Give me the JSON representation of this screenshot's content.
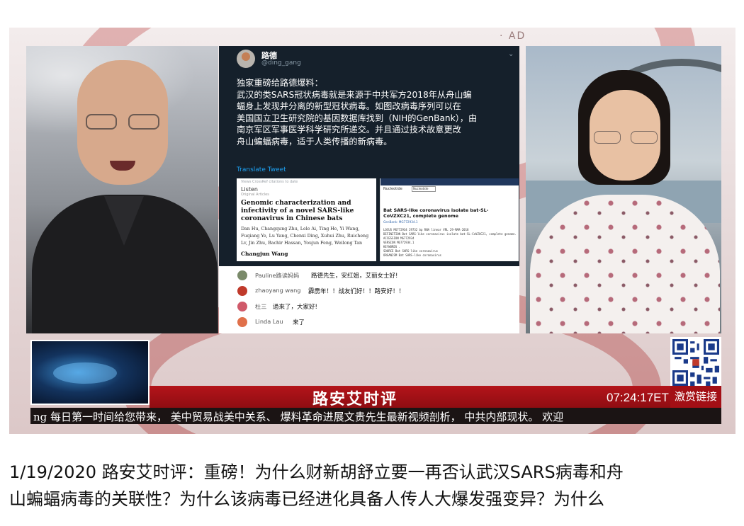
{
  "video": {
    "ad_text": "· AD",
    "tweet": {
      "display_name": "路德",
      "handle": "@ding_gang",
      "chevron": "⌄",
      "body_lines": [
        "独家重磅给路德爆料：",
        "武汉的类SARS冠状病毒就是来源于中共军方2018年从舟山蝙",
        "蝠身上发现并分离的新型冠状病毒。如图改病毒序列可以在",
        "美国国立卫生研究院的基因数据库找到（NIH的GenBank），由",
        "南京军区军事医学科学研究所递交。并且通过技术故意更改",
        "舟山蝙蝠病毒，适于人类传播的新病毒。"
      ],
      "translate_link": "Translate Tweet",
      "paper": {
        "header": "Views   CrossRef citations to date",
        "listen": "Listen",
        "article_type": "Original Articles",
        "title": "Genomic characterization and infectivity of a novel SARS-like coronavirus in Chinese bats",
        "authors": "Dan Hu, Changqung Zhu, Lele Ai, Ting He, Yi Wang, Fuqiang Ye, Lu Yang, Chenxi Ding, Xuhui Zhu, Ruicheng Lv, Jin Zhu, Bachir Hassan, Youjun Feng, Weilong Tan",
        "corresponding": "Changjun Wang"
      },
      "genbank": {
        "select_label": "Nucleotide",
        "select_value": "Nucleotide",
        "title": "Bat SARS-like coronavirus isolate bat-SL-CoVZXC21, complete genome",
        "accession": "GenBank: MG772934.1",
        "lines": [
          "LOCUS       MG772934       29732 bp    RNA     linear   VRL 29-MAR-2018",
          "DEFINITION  Bat SARS-like coronavirus isolate bat-SL-CoVZXC21, complete genome.",
          "ACCESSION   MG772934",
          "VERSION     MG772934.1",
          "KEYWORDS    .",
          "SOURCE      Bat SARS-like coronavirus",
          "  ORGANISM  Bat SARS-like coronavirus"
        ]
      }
    },
    "chat": [
      {
        "user": "Pauline路读妈妈",
        "message": "路德先生，安红姐，艾丽女士好!",
        "avatar_color": "#7a8a6a"
      },
      {
        "user": "zhaoyang wang",
        "message": "霹雳年！！战友们好！！路安好！！",
        "avatar_color": "#c03a2b"
      },
      {
        "user": "杜三",
        "message": "過來了，大家好!",
        "avatar_color": "#d05a6a"
      },
      {
        "user": "Linda Lau",
        "message": "来了",
        "avatar_color": "#e0704a"
      }
    ],
    "lower_third": {
      "show_title": "路安艾时评",
      "clock": "07:24:17ET",
      "tip_button": "激赏链接",
      "ticker": "ng 每日第一时间给您带来， 美中贸易战美中关系、 爆料革命进展文贵先生最新视频剖析， 中共内部现状。 欢迎"
    }
  },
  "caption": {
    "lines": [
      "1/19/2020 路安艾时评：重磅！为什么财新胡舒立要一再否认武汉SARS病毒和舟",
      "山蝙蝠病毒的关联性？为什么该病毒已经进化具备人传人大爆发强变异？为什么"
    ]
  },
  "colors": {
    "tweet_background": "#15202b",
    "link_blue": "#1da1f2",
    "banner_red": "#b4141a"
  }
}
